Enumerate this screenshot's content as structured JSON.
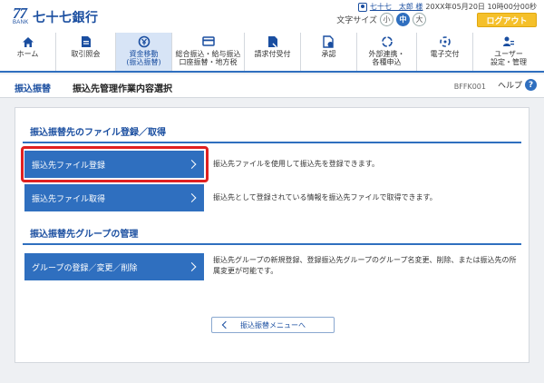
{
  "header": {
    "logo_number": "77",
    "logo_bank": "BANK",
    "bank_name": "七十七銀行",
    "user_name": "七十七　太郎 様",
    "datetime": "20XX年05月20日 10時00分00秒",
    "font_size_label": "文字サイズ",
    "font_sizes": [
      "小",
      "中",
      "大"
    ],
    "logout_label": "ログアウト"
  },
  "nav": {
    "items": [
      {
        "label": "ホーム",
        "icon": "home-icon"
      },
      {
        "label": "取引照会",
        "icon": "document-icon"
      },
      {
        "label": "資金移動\n(振込振替)",
        "icon": "yen-transfer-icon",
        "selected": true
      },
      {
        "label": "総合振込・給与振込\n口座振替・地方税",
        "icon": "card-icon"
      },
      {
        "label": "請求付受付",
        "icon": "invoice-icon"
      },
      {
        "label": "承認",
        "icon": "approval-icon"
      },
      {
        "label": "外部連携・\n各種申込",
        "icon": "link-icon"
      },
      {
        "label": "電子交付",
        "icon": "electronic-icon"
      },
      {
        "label": "ユーザー\n設定・管理",
        "icon": "user-settings-icon"
      }
    ]
  },
  "titlebar": {
    "section": "振込振替",
    "page_title": "振込先管理作業内容選択",
    "screen_code": "BFFK001",
    "help_label": "ヘルプ",
    "help_icon": "?"
  },
  "sections": [
    {
      "heading": "振込振替先のファイル登録／取得",
      "actions": [
        {
          "label": "振込先ファイル登録",
          "description": "振込先ファイルを使用して振込先を登録できます。"
        },
        {
          "label": "振込先ファイル取得",
          "description": "振込先として登録されている情報を振込先ファイルで取得できます。"
        }
      ]
    },
    {
      "heading": "振込振替先グループの管理",
      "actions": [
        {
          "label": "グループの登録／変更／削除",
          "description": "振込先グループの新規登録、登録振込先グループのグループ名変更、削除、または振込先の所属変更が可能です。"
        }
      ]
    }
  ],
  "back_button_label": "振込振替メニューへ",
  "colors": {
    "brand_blue": "#2f6fbf",
    "logo_blue": "#1a4ea0",
    "logout_yellow": "#f5c02a",
    "highlight_red": "#e02020"
  }
}
